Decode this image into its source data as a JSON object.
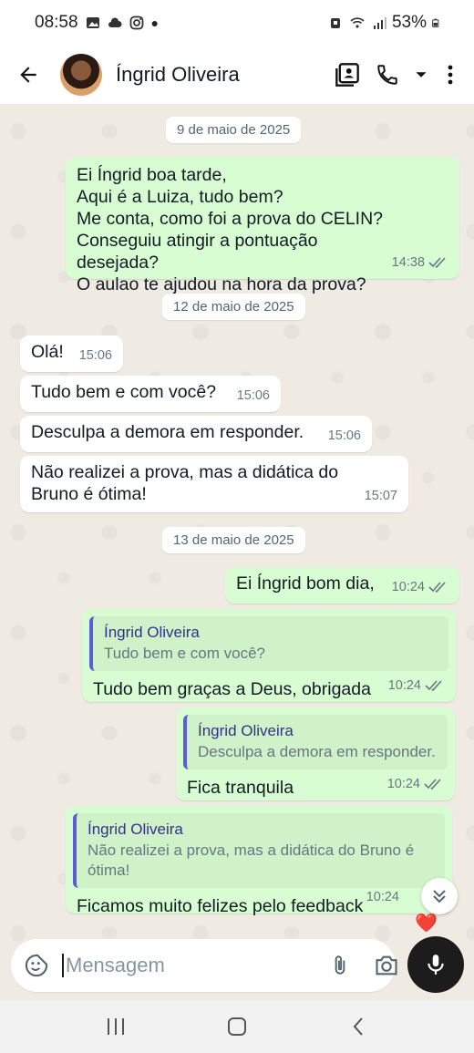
{
  "status": {
    "time": "08:58",
    "battery": "53%"
  },
  "header": {
    "contact_name": "Íngrid Oliveira"
  },
  "chat": {
    "dates": [
      "9 de maio de 2025",
      "12 de maio de 2025",
      "13 de maio de 2025"
    ],
    "messages": [
      {
        "dir": "out",
        "text": "Ei Íngrid boa tarde,\nAqui é a Luiza, tudo bem?\nMe conta, como foi a prova do CELIN?\nConseguiu atingir a pontuação desejada?\nO aulao te ajudou na hora da prova?",
        "time": "14:38",
        "ticks": true
      },
      {
        "dir": "in",
        "text": "Olá!",
        "time": "15:06"
      },
      {
        "dir": "in",
        "text": "Tudo bem e com você?",
        "time": "15:06"
      },
      {
        "dir": "in",
        "text": "Desculpa a demora em responder.",
        "time": "15:06"
      },
      {
        "dir": "in",
        "text": "Não realizei a prova, mas a didática do\nBruno é ótima!",
        "time": "15:07"
      },
      {
        "dir": "out",
        "text": "Ei Íngrid bom dia,",
        "time": "10:24",
        "ticks": true
      },
      {
        "dir": "out",
        "quote_name": "Íngrid Oliveira",
        "quote_text": "Tudo bem e com você?",
        "text": "Tudo bem graças a Deus, obrigada",
        "time": "10:24",
        "ticks": true
      },
      {
        "dir": "out",
        "quote_name": "Íngrid Oliveira",
        "quote_text": "Desculpa a demora em responder.",
        "text": "Fica tranquila",
        "time": "10:24",
        "ticks": true
      },
      {
        "dir": "out",
        "quote_name": "Íngrid Oliveira",
        "quote_text": "Não realizei a prova, mas a didática do Bruno é\nótima!",
        "text": "Ficamos muito felizes pelo feedback",
        "time": "10:24",
        "reaction": "❤️"
      }
    ]
  },
  "composer": {
    "placeholder": "Mensagem"
  },
  "colors": {
    "outgoing_bubble": "#d9fdd3",
    "incoming_bubble": "#ffffff",
    "chat_background": "#efeae2",
    "read_ticks": "#667781"
  }
}
